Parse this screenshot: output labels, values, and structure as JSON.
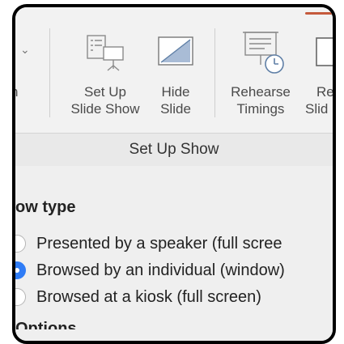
{
  "ribbon": {
    "partial_left_label": "n",
    "setup_slideshow": {
      "line1": "Set Up",
      "line2": "Slide Show",
      "icon": "setup-slideshow-icon"
    },
    "hide_slide": {
      "line1": "Hide",
      "line2": "Slide",
      "icon": "hide-slide-icon"
    },
    "rehearse_timings": {
      "line1": "Rehearse",
      "line2": "Timings",
      "icon": "rehearse-timings-icon"
    },
    "partial_right": {
      "line1": "Re",
      "line2": "Slid",
      "icon": "record-slideshow-icon"
    },
    "group_label": "Set Up Show"
  },
  "dialog": {
    "section_title": "ow type",
    "options": [
      {
        "label": "Presented by a speaker (full scree",
        "selected": false
      },
      {
        "label": "Browsed by an individual (window)",
        "selected": true
      },
      {
        "label": "Browsed at a kiosk (full screen)",
        "selected": false
      }
    ],
    "next_section": "Options"
  },
  "colors": {
    "accent": "#c55a3c",
    "radio_selected": "#2f7cf6"
  }
}
